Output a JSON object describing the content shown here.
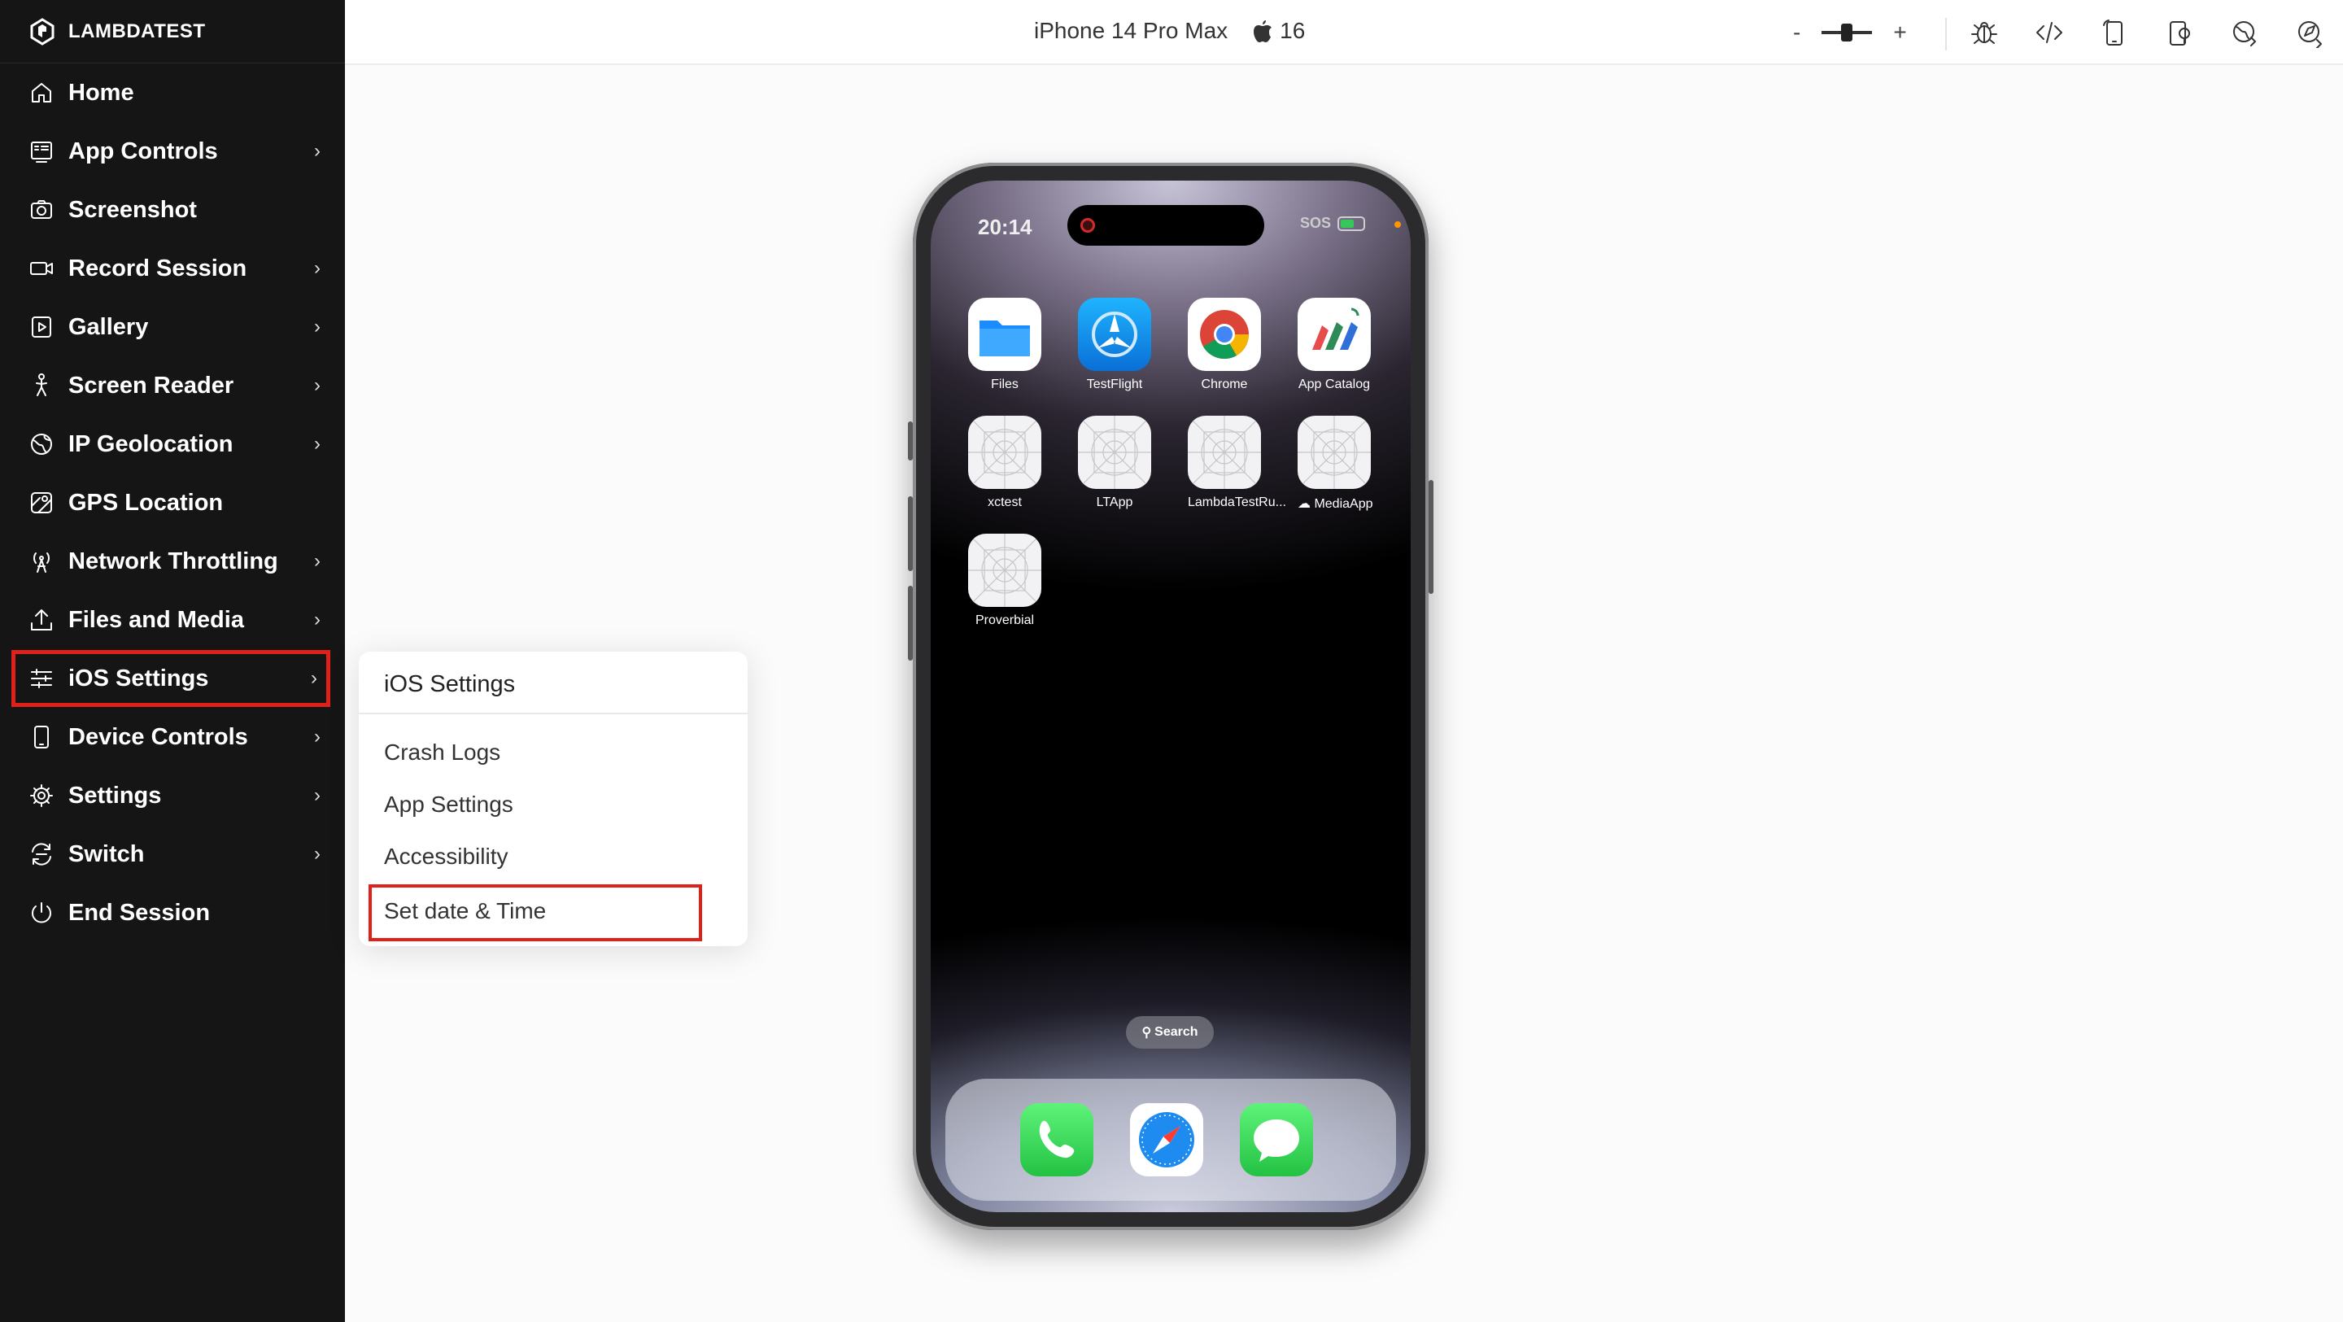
{
  "brand": {
    "name": "LAMBDATEST"
  },
  "sidebar": {
    "items": [
      {
        "label": "Home",
        "icon": "home-icon",
        "has_submenu": false
      },
      {
        "label": "App Controls",
        "icon": "app-controls-icon",
        "has_submenu": true
      },
      {
        "label": "Screenshot",
        "icon": "camera-icon",
        "has_submenu": false
      },
      {
        "label": "Record Session",
        "icon": "video-icon",
        "has_submenu": true
      },
      {
        "label": "Gallery",
        "icon": "gallery-icon",
        "has_submenu": true
      },
      {
        "label": "Screen Reader",
        "icon": "accessibility-icon",
        "has_submenu": true
      },
      {
        "label": "IP Geolocation",
        "icon": "globe-icon",
        "has_submenu": true
      },
      {
        "label": "GPS Location",
        "icon": "map-icon",
        "has_submenu": false
      },
      {
        "label": "Network Throttling",
        "icon": "antenna-icon",
        "has_submenu": true
      },
      {
        "label": "Files and Media",
        "icon": "upload-icon",
        "has_submenu": true
      },
      {
        "label": "iOS Settings",
        "icon": "sliders-icon",
        "has_submenu": true,
        "highlighted": true
      },
      {
        "label": "Device Controls",
        "icon": "device-icon",
        "has_submenu": true
      },
      {
        "label": "Settings",
        "icon": "gear-icon",
        "has_submenu": true
      },
      {
        "label": "Switch",
        "icon": "switch-icon",
        "has_submenu": true
      },
      {
        "label": "End Session",
        "icon": "power-icon",
        "has_submenu": false
      }
    ],
    "chevron": "›"
  },
  "topbar": {
    "device_name": "iPhone 14 Pro Max",
    "os_version": "16",
    "zoom_minus": "-",
    "zoom_plus": "+"
  },
  "submenu": {
    "title": "iOS Settings",
    "items": [
      "Crash Logs",
      "App Settings",
      "Accessibility",
      "Set date & Time"
    ],
    "highlighted_item": "Set date & Time"
  },
  "phone": {
    "time": "20:14",
    "carrier": "SOS",
    "apps": [
      {
        "name": "Files"
      },
      {
        "name": "TestFlight"
      },
      {
        "name": "Chrome"
      },
      {
        "name": "App Catalog"
      },
      {
        "name": "xctest"
      },
      {
        "name": "LTApp"
      },
      {
        "name": "LambdaTestRu..."
      },
      {
        "name": "MediaApp"
      },
      {
        "name": "Proverbial"
      }
    ],
    "search_label": "Search",
    "dock": [
      "phone-app-icon",
      "safari-icon",
      "messages-icon"
    ]
  },
  "colors": {
    "sidebar_bg": "#151515",
    "highlight_red": "#e0201b",
    "content_bg": "#fbfbfb"
  }
}
